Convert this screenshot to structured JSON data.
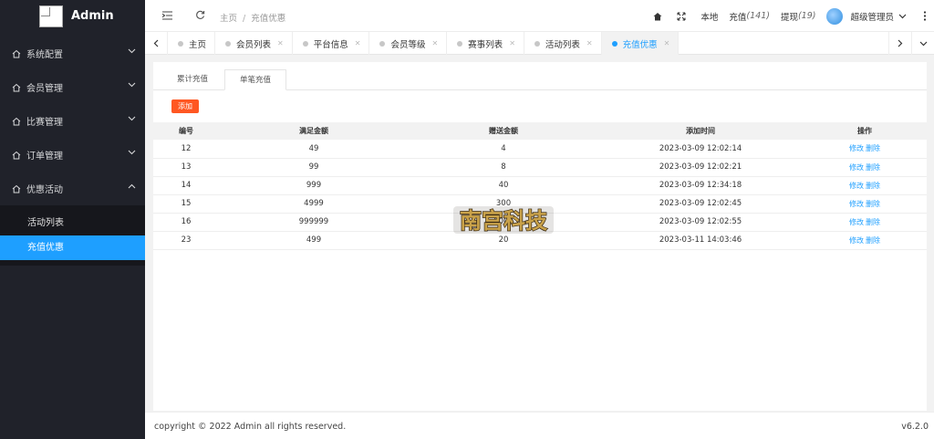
{
  "brand": {
    "title": "Admin"
  },
  "sidebar": {
    "items": [
      {
        "label": "系统配置"
      },
      {
        "label": "会员管理"
      },
      {
        "label": "比赛管理"
      },
      {
        "label": "订单管理"
      },
      {
        "label": "优惠活动"
      }
    ],
    "submenu": [
      {
        "label": "活动列表"
      },
      {
        "label": "充值优惠"
      }
    ]
  },
  "header": {
    "breadcrumb": [
      "主页",
      "充值优惠"
    ],
    "local_label": "本地",
    "recharge_label": "充值",
    "recharge_count": "(141)",
    "withdraw_label": "提现",
    "withdraw_count": "(19)",
    "user_name": "超级管理员"
  },
  "tabs": [
    {
      "label": "主页"
    },
    {
      "label": "会员列表"
    },
    {
      "label": "平台信息"
    },
    {
      "label": "会员等级"
    },
    {
      "label": "赛事列表"
    },
    {
      "label": "活动列表"
    },
    {
      "label": "充值优惠"
    }
  ],
  "content": {
    "sub_tabs": [
      "累计充值",
      "单笔充值"
    ],
    "add_button": "添加",
    "columns": [
      "编号",
      "满足金额",
      "赠送金额",
      "添加时间",
      "操作"
    ],
    "rows": [
      {
        "id": "12",
        "min": "49",
        "bonus": "4",
        "time": "2023-03-09 12:02:14"
      },
      {
        "id": "13",
        "min": "99",
        "bonus": "8",
        "time": "2023-03-09 12:02:21"
      },
      {
        "id": "14",
        "min": "999",
        "bonus": "40",
        "time": "2023-03-09 12:34:18"
      },
      {
        "id": "15",
        "min": "4999",
        "bonus": "300",
        "time": "2023-03-09 12:02:45"
      },
      {
        "id": "16",
        "min": "999999",
        "bonus": "5000",
        "time": "2023-03-09 12:02:55"
      },
      {
        "id": "23",
        "min": "499",
        "bonus": "20",
        "time": "2023-03-11 14:03:46"
      }
    ],
    "edit_label": "修改",
    "delete_label": "删除"
  },
  "watermark": {
    "text": "南宫科技"
  },
  "footer": {
    "copyright": "copyright © 2022 Admin all rights reserved.",
    "version": "v6.2.0"
  },
  "colors": {
    "accent": "#1e9fff",
    "danger": "#ff5722",
    "sidebar_bg": "#20222a"
  }
}
